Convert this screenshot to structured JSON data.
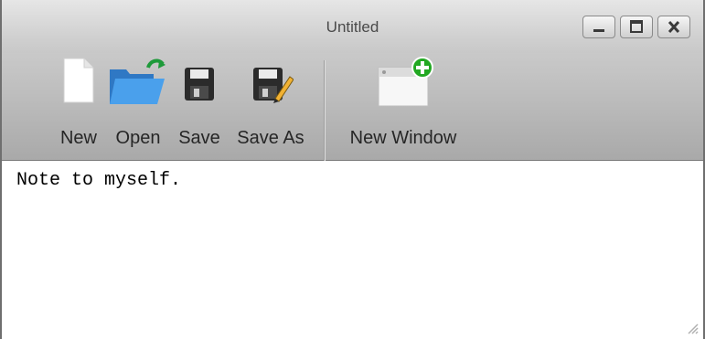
{
  "window": {
    "title": "Untitled",
    "controls": [
      "minimize",
      "maximize",
      "close"
    ]
  },
  "toolbar": {
    "new_label": "New",
    "open_label": "Open",
    "save_label": "Save",
    "save_as_label": "Save As",
    "new_window_label": "New Window"
  },
  "icons": {
    "new": "blank-document-icon",
    "open": "folder-open-icon",
    "save": "floppy-disk-icon",
    "save_as": "floppy-pencil-icon",
    "new_window": "window-plus-icon"
  },
  "editor": {
    "text": "Note to myself."
  },
  "colors": {
    "titlebar": "#d6d6d6",
    "toolbar": "#bdbdbd",
    "folder": "#3f8fdc",
    "plus": "#1fa81f"
  }
}
